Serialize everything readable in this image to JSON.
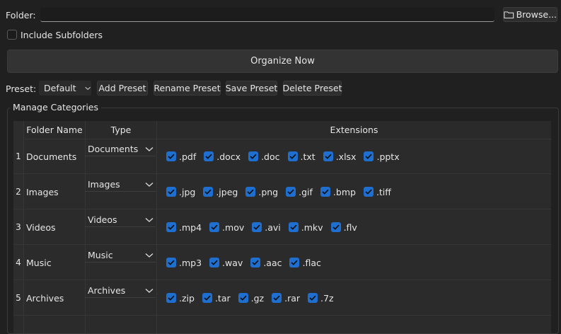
{
  "folder": {
    "label": "Folder:",
    "value": "",
    "placeholder": "",
    "browse_label": "Browse..."
  },
  "include_subfolders": {
    "label": "Include Subfolders",
    "checked": false
  },
  "organize_label": "Organize Now",
  "preset": {
    "label": "Preset:",
    "selected": "Default",
    "buttons": {
      "add": "Add Preset",
      "rename": "Rename Preset",
      "save": "Save Preset",
      "delete": "Delete Preset"
    }
  },
  "categories": {
    "title": "Manage Categories",
    "headers": {
      "folder_name": "Folder Name",
      "type": "Type",
      "extensions": "Extensions"
    },
    "rows": [
      {
        "num": "1",
        "folder": "Documents",
        "type": "Documents",
        "extensions": [
          ".pdf",
          ".docx",
          ".doc",
          ".txt",
          ".xlsx",
          ".pptx"
        ]
      },
      {
        "num": "2",
        "folder": "Images",
        "type": "Images",
        "extensions": [
          ".jpg",
          ".jpeg",
          ".png",
          ".gif",
          ".bmp",
          ".tiff"
        ]
      },
      {
        "num": "3",
        "folder": "Videos",
        "type": "Videos",
        "extensions": [
          ".mp4",
          ".mov",
          ".avi",
          ".mkv",
          ".flv"
        ]
      },
      {
        "num": "4",
        "folder": "Music",
        "type": "Music",
        "extensions": [
          ".mp3",
          ".wav",
          ".aac",
          ".flac"
        ]
      },
      {
        "num": "5",
        "folder": "Archives",
        "type": "Archives",
        "extensions": [
          ".zip",
          ".tar",
          ".gz",
          ".rar",
          ".7z"
        ]
      }
    ]
  },
  "colors": {
    "checkbox": "#1f6fd1",
    "background": "#202020"
  }
}
